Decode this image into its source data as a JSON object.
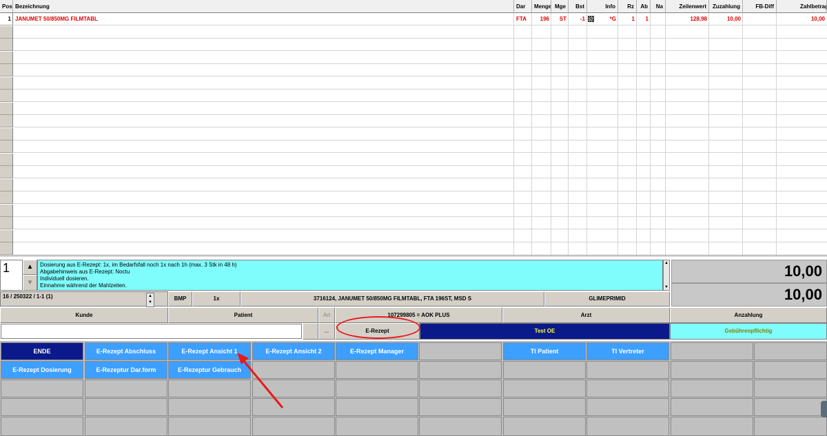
{
  "grid": {
    "columns": [
      "Pos",
      "Bezeichnung",
      "Dar",
      "Menge",
      "Mge",
      "Bst",
      "Info",
      "Rz",
      "Ab",
      "Na",
      "Zeilenwert",
      "Zuzahlung",
      "FB-Diff",
      "Zahlbetrag"
    ],
    "row": {
      "pos": "1",
      "bezeichnung": "JANUMET 50/850MG FILMTABL",
      "dar": "FTA",
      "menge": "196",
      "mge": "ST",
      "bst": "-1",
      "info": "*G",
      "rz": "1",
      "ab": "1",
      "na": "",
      "zeilenwert": "128,98",
      "zuzahlung": "10,00",
      "fbdiff": "",
      "zahlbetrag": "10,00"
    }
  },
  "detail": {
    "position_value": "1",
    "text_lines": [
      "Dosierung aus E-Rezept: 1x, im Bedarfsfall noch 1x nach 1h (max. 3 Stk in 48 h)",
      "Abgabehinweis aus E-Rezept: Noctu",
      "Individuell dosieren.",
      "Einnahme während der Mahlzeiten."
    ],
    "total_top": "10,00",
    "total_bottom": "10,00"
  },
  "info_row": {
    "counter": "16 / 250322 / 1-1 (1)",
    "bmp": "BMP",
    "qty": "1x",
    "article": "3716124, JANUMET 50/850MG FILMTABL, FTA   196ST, MSD S",
    "interaction": "GLIMEPRIMID"
  },
  "labels_row": {
    "kunde": "Kunde",
    "patient": "Patient",
    "art": "Art",
    "insurer": "107299805 = AOK PLUS",
    "arzt": "Arzt",
    "anzahlung": "Anzahlung"
  },
  "value_row": {
    "kunde_value": "",
    "dots": "...",
    "erezept": "E-Rezept",
    "arzt_value": "Test OE",
    "status": "Gebührenpflichtig"
  },
  "tiles": {
    "row1": [
      "ENDE",
      "E-Rezept Abschluss",
      "E-Rezept Ansicht 1",
      "E-Rezept Ansicht 2",
      "E-Rezept Manager",
      "",
      "TI Patient",
      "TI Vertreter",
      "",
      ""
    ],
    "row2": [
      "E-Rezept Dosierung",
      "E-Rezeptur Dar.form",
      "E-Rezeptur Gebrauch",
      "",
      "",
      "",
      "",
      "",
      "",
      ""
    ]
  },
  "colors": {
    "tile_light": "#3d9fff",
    "tile_dark": "#0b1a8a",
    "detail_bg": "#7ffcfc",
    "highlight_red": "#e00000"
  }
}
